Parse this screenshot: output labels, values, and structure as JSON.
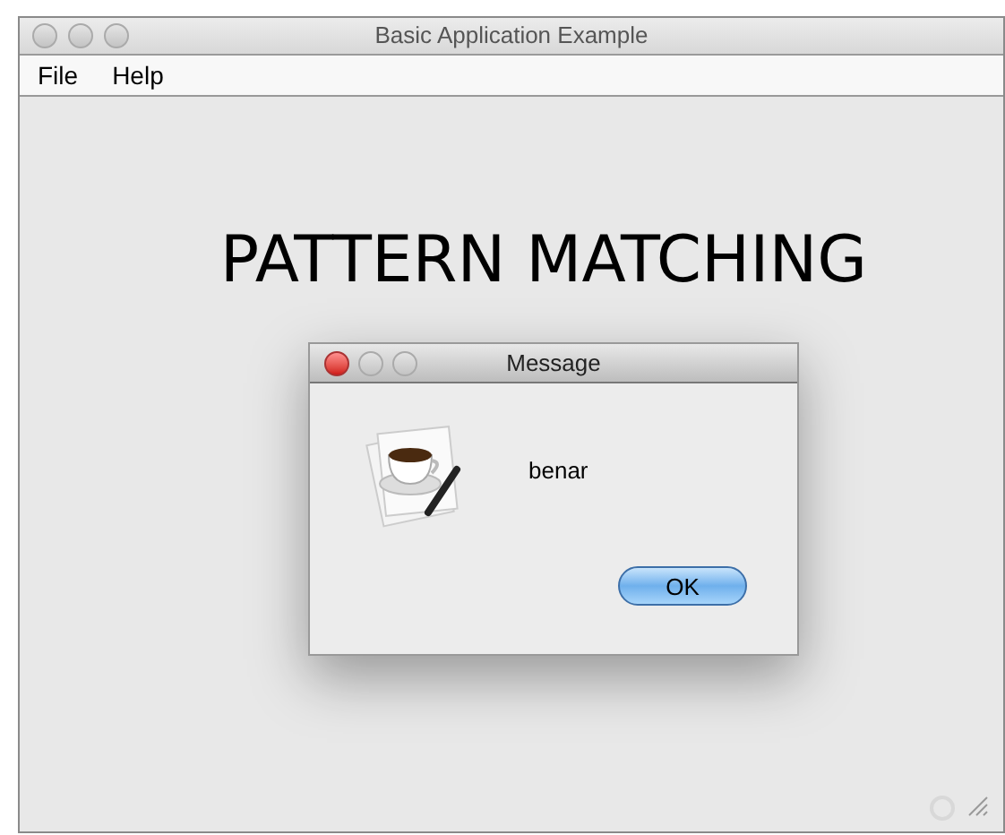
{
  "window": {
    "title": "Basic Application Example"
  },
  "menu": [
    "File",
    "Help"
  ],
  "heading": "PATTERN MATCHING",
  "dialog": {
    "title": "Message",
    "message": "benar",
    "button": "OK"
  }
}
